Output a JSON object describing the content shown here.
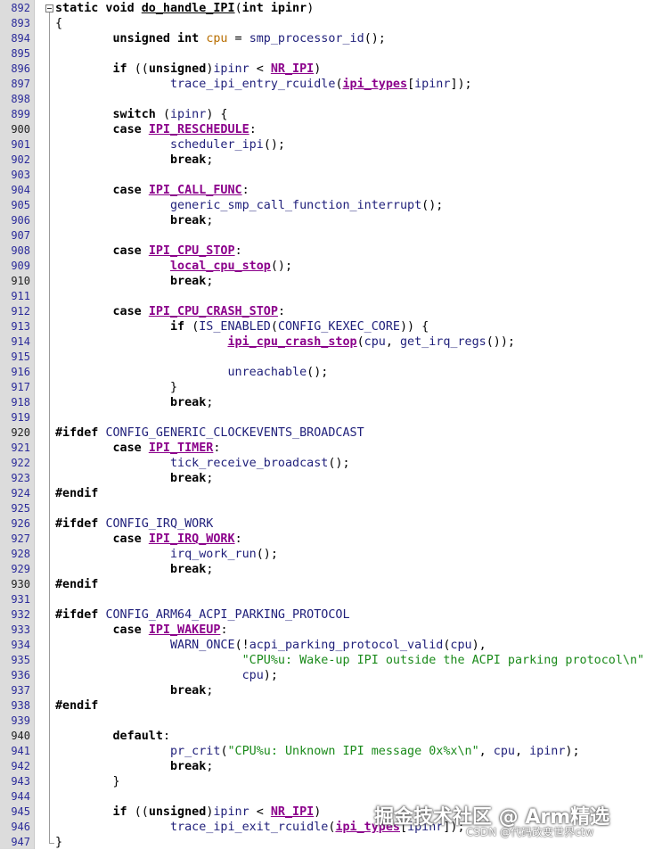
{
  "editor": {
    "colors": {
      "gutter": "#dcdcdc",
      "line_number": "#2b2b9a",
      "keyword": "#000000",
      "identifier": "#1f1f7a",
      "macro": "#8b008b",
      "variable": "#b86e00",
      "string": "#1a8a1a"
    },
    "lines": [
      {
        "n": "892",
        "t": [
          [
            "kw",
            "static void "
          ],
          [
            "fn",
            "do_handle_IPI"
          ],
          [
            "p",
            "("
          ],
          [
            "kw",
            "int ipinr"
          ],
          [
            "p",
            ")"
          ]
        ]
      },
      {
        "n": "893",
        "t": [
          [
            "p",
            "{"
          ]
        ]
      },
      {
        "n": "894",
        "t": [
          [
            "p",
            "        "
          ],
          [
            "kw",
            "unsigned int "
          ],
          [
            "var",
            "cpu"
          ],
          [
            "p",
            " = "
          ],
          [
            "call",
            "smp_processor_id"
          ],
          [
            "p",
            "();"
          ]
        ]
      },
      {
        "n": "895",
        "t": []
      },
      {
        "n": "896",
        "t": [
          [
            "p",
            "        "
          ],
          [
            "kw",
            "if "
          ],
          [
            "p",
            "(("
          ],
          [
            "kw",
            "unsigned"
          ],
          [
            "p",
            ")"
          ],
          [
            "id",
            "ipinr"
          ],
          [
            "p",
            " < "
          ],
          [
            "mac",
            "NR_IPI"
          ],
          [
            "p",
            ")"
          ]
        ]
      },
      {
        "n": "897",
        "t": [
          [
            "p",
            "                "
          ],
          [
            "call",
            "trace_ipi_entry_rcuidle"
          ],
          [
            "p",
            "("
          ],
          [
            "lcall",
            "ipi_types"
          ],
          [
            "p",
            "["
          ],
          [
            "id",
            "ipinr"
          ],
          [
            "p",
            "]);"
          ]
        ]
      },
      {
        "n": "898",
        "t": []
      },
      {
        "n": "899",
        "t": [
          [
            "p",
            "        "
          ],
          [
            "kw",
            "switch "
          ],
          [
            "p",
            "("
          ],
          [
            "id",
            "ipinr"
          ],
          [
            "p",
            ") {"
          ]
        ]
      },
      {
        "n": "900",
        "m": true,
        "t": [
          [
            "p",
            "        "
          ],
          [
            "kw",
            "case "
          ],
          [
            "mac",
            "IPI_RESCHEDULE"
          ],
          [
            "p",
            ":"
          ]
        ]
      },
      {
        "n": "901",
        "t": [
          [
            "p",
            "                "
          ],
          [
            "call",
            "scheduler_ipi"
          ],
          [
            "p",
            "();"
          ]
        ]
      },
      {
        "n": "902",
        "t": [
          [
            "p",
            "                "
          ],
          [
            "kw",
            "break"
          ],
          [
            "p",
            ";"
          ]
        ]
      },
      {
        "n": "903",
        "t": []
      },
      {
        "n": "904",
        "t": [
          [
            "p",
            "        "
          ],
          [
            "kw",
            "case "
          ],
          [
            "mac",
            "IPI_CALL_FUNC"
          ],
          [
            "p",
            ":"
          ]
        ]
      },
      {
        "n": "905",
        "t": [
          [
            "p",
            "                "
          ],
          [
            "call",
            "generic_smp_call_function_interrupt"
          ],
          [
            "p",
            "();"
          ]
        ]
      },
      {
        "n": "906",
        "t": [
          [
            "p",
            "                "
          ],
          [
            "kw",
            "break"
          ],
          [
            "p",
            ";"
          ]
        ]
      },
      {
        "n": "907",
        "t": []
      },
      {
        "n": "908",
        "t": [
          [
            "p",
            "        "
          ],
          [
            "kw",
            "case "
          ],
          [
            "mac",
            "IPI_CPU_STOP"
          ],
          [
            "p",
            ":"
          ]
        ]
      },
      {
        "n": "909",
        "t": [
          [
            "p",
            "                "
          ],
          [
            "lcall",
            "local_cpu_stop"
          ],
          [
            "p",
            "();"
          ]
        ]
      },
      {
        "n": "910",
        "m": true,
        "t": [
          [
            "p",
            "                "
          ],
          [
            "kw",
            "break"
          ],
          [
            "p",
            ";"
          ]
        ]
      },
      {
        "n": "911",
        "t": []
      },
      {
        "n": "912",
        "t": [
          [
            "p",
            "        "
          ],
          [
            "kw",
            "case "
          ],
          [
            "mac",
            "IPI_CPU_CRASH_STOP"
          ],
          [
            "p",
            ":"
          ]
        ]
      },
      {
        "n": "913",
        "t": [
          [
            "p",
            "                "
          ],
          [
            "kw",
            "if "
          ],
          [
            "p",
            "("
          ],
          [
            "call",
            "IS_ENABLED"
          ],
          [
            "p",
            "("
          ],
          [
            "id",
            "CONFIG_KEXEC_CORE"
          ],
          [
            "p",
            ")) {"
          ]
        ]
      },
      {
        "n": "914",
        "t": [
          [
            "p",
            "                        "
          ],
          [
            "lcall",
            "ipi_cpu_crash_stop"
          ],
          [
            "p",
            "("
          ],
          [
            "id",
            "cpu"
          ],
          [
            "p",
            ", "
          ],
          [
            "call",
            "get_irq_regs"
          ],
          [
            "p",
            "());"
          ]
        ]
      },
      {
        "n": "915",
        "t": []
      },
      {
        "n": "916",
        "t": [
          [
            "p",
            "                        "
          ],
          [
            "call",
            "unreachable"
          ],
          [
            "p",
            "();"
          ]
        ]
      },
      {
        "n": "917",
        "t": [
          [
            "p",
            "                }"
          ]
        ]
      },
      {
        "n": "918",
        "t": [
          [
            "p",
            "                "
          ],
          [
            "kw",
            "break"
          ],
          [
            "p",
            ";"
          ]
        ]
      },
      {
        "n": "919",
        "t": []
      },
      {
        "n": "920",
        "m": true,
        "t": [
          [
            "pre",
            "#ifdef "
          ],
          [
            "pp",
            "CONFIG_GENERIC_CLOCKEVENTS_BROADCAST"
          ]
        ]
      },
      {
        "n": "921",
        "t": [
          [
            "p",
            "        "
          ],
          [
            "kw",
            "case "
          ],
          [
            "mac",
            "IPI_TIMER"
          ],
          [
            "p",
            ":"
          ]
        ]
      },
      {
        "n": "922",
        "t": [
          [
            "p",
            "                "
          ],
          [
            "call",
            "tick_receive_broadcast"
          ],
          [
            "p",
            "();"
          ]
        ]
      },
      {
        "n": "923",
        "t": [
          [
            "p",
            "                "
          ],
          [
            "kw",
            "break"
          ],
          [
            "p",
            ";"
          ]
        ]
      },
      {
        "n": "924",
        "t": [
          [
            "pre",
            "#endif"
          ]
        ]
      },
      {
        "n": "925",
        "t": []
      },
      {
        "n": "926",
        "t": [
          [
            "pre",
            "#ifdef "
          ],
          [
            "pp",
            "CONFIG_IRQ_WORK"
          ]
        ]
      },
      {
        "n": "927",
        "t": [
          [
            "p",
            "        "
          ],
          [
            "kw",
            "case "
          ],
          [
            "mac",
            "IPI_IRQ_WORK"
          ],
          [
            "p",
            ":"
          ]
        ]
      },
      {
        "n": "928",
        "t": [
          [
            "p",
            "                "
          ],
          [
            "call",
            "irq_work_run"
          ],
          [
            "p",
            "();"
          ]
        ]
      },
      {
        "n": "929",
        "t": [
          [
            "p",
            "                "
          ],
          [
            "kw",
            "break"
          ],
          [
            "p",
            ";"
          ]
        ]
      },
      {
        "n": "930",
        "m": true,
        "t": [
          [
            "pre",
            "#endif"
          ]
        ]
      },
      {
        "n": "931",
        "t": []
      },
      {
        "n": "932",
        "t": [
          [
            "pre",
            "#ifdef "
          ],
          [
            "pp",
            "CONFIG_ARM64_ACPI_PARKING_PROTOCOL"
          ]
        ]
      },
      {
        "n": "933",
        "t": [
          [
            "p",
            "        "
          ],
          [
            "kw",
            "case "
          ],
          [
            "mac",
            "IPI_WAKEUP"
          ],
          [
            "p",
            ":"
          ]
        ]
      },
      {
        "n": "934",
        "t": [
          [
            "p",
            "                "
          ],
          [
            "call",
            "WARN_ONCE"
          ],
          [
            "p",
            "(!"
          ],
          [
            "call",
            "acpi_parking_protocol_valid"
          ],
          [
            "p",
            "("
          ],
          [
            "id",
            "cpu"
          ],
          [
            "p",
            "),"
          ]
        ]
      },
      {
        "n": "935",
        "t": [
          [
            "p",
            "                          "
          ],
          [
            "str",
            "\"CPU%u: Wake-up IPI outside the ACPI parking protocol\\n\""
          ],
          [
            "p",
            ","
          ]
        ]
      },
      {
        "n": "936",
        "t": [
          [
            "p",
            "                          "
          ],
          [
            "id",
            "cpu"
          ],
          [
            "p",
            ");"
          ]
        ]
      },
      {
        "n": "937",
        "t": [
          [
            "p",
            "                "
          ],
          [
            "kw",
            "break"
          ],
          [
            "p",
            ";"
          ]
        ]
      },
      {
        "n": "938",
        "t": [
          [
            "pre",
            "#endif"
          ]
        ]
      },
      {
        "n": "939",
        "t": []
      },
      {
        "n": "940",
        "m": true,
        "t": [
          [
            "p",
            "        "
          ],
          [
            "kw",
            "default"
          ],
          [
            "p",
            ":"
          ]
        ]
      },
      {
        "n": "941",
        "t": [
          [
            "p",
            "                "
          ],
          [
            "call",
            "pr_crit"
          ],
          [
            "p",
            "("
          ],
          [
            "str",
            "\"CPU%u: Unknown IPI message 0x%x\\n\""
          ],
          [
            "p",
            ", "
          ],
          [
            "id",
            "cpu"
          ],
          [
            "p",
            ", "
          ],
          [
            "id",
            "ipinr"
          ],
          [
            "p",
            ");"
          ]
        ]
      },
      {
        "n": "942",
        "t": [
          [
            "p",
            "                "
          ],
          [
            "kw",
            "break"
          ],
          [
            "p",
            ";"
          ]
        ]
      },
      {
        "n": "943",
        "t": [
          [
            "p",
            "        }"
          ]
        ]
      },
      {
        "n": "944",
        "t": []
      },
      {
        "n": "945",
        "t": [
          [
            "p",
            "        "
          ],
          [
            "kw",
            "if "
          ],
          [
            "p",
            "(("
          ],
          [
            "kw",
            "unsigned"
          ],
          [
            "p",
            ")"
          ],
          [
            "id",
            "ipinr"
          ],
          [
            "p",
            " < "
          ],
          [
            "mac",
            "NR_IPI"
          ],
          [
            "p",
            ")"
          ]
        ]
      },
      {
        "n": "946",
        "t": [
          [
            "p",
            "                "
          ],
          [
            "call",
            "trace_ipi_exit_rcuidle"
          ],
          [
            "p",
            "("
          ],
          [
            "lcall",
            "ipi_types"
          ],
          [
            "p",
            "["
          ],
          [
            "id",
            "ipinr"
          ],
          [
            "p",
            "]);"
          ]
        ]
      },
      {
        "n": "947",
        "t": [
          [
            "p",
            "}"
          ]
        ]
      }
    ]
  },
  "overlay": {
    "watermark": "掘金技术社区 @ Arm精选",
    "credit": "CSDN @代码改变世界ctw"
  }
}
